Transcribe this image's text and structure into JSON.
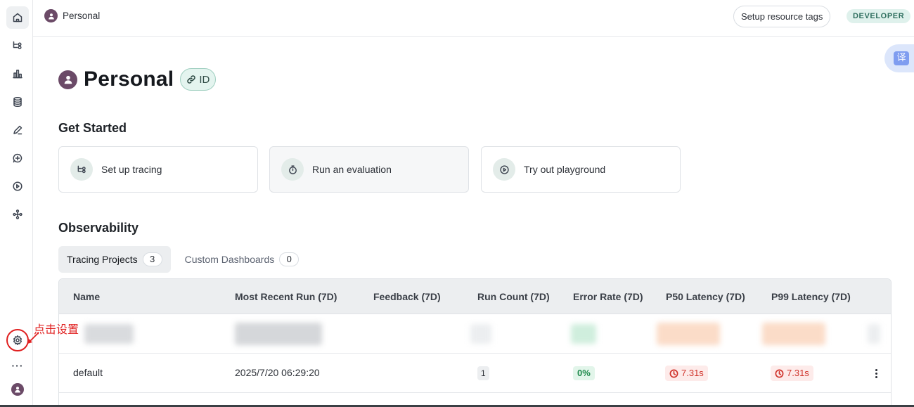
{
  "header": {
    "breadcrumb": "Personal",
    "setup_tags_label": "Setup resource tags",
    "plan_badge": "DEVELOPER"
  },
  "translate_widget": {
    "glyph": "译"
  },
  "page": {
    "title": "Personal",
    "id_chip": "ID"
  },
  "get_started": {
    "heading": "Get Started",
    "cards": [
      {
        "label": "Set up tracing",
        "icon": "tracing-icon"
      },
      {
        "label": "Run an evaluation",
        "icon": "stopwatch-icon"
      },
      {
        "label": "Try out playground",
        "icon": "play-circle-icon"
      }
    ]
  },
  "observability": {
    "heading": "Observability",
    "tabs": [
      {
        "label": "Tracing Projects",
        "count": "3"
      },
      {
        "label": "Custom Dashboards",
        "count": "0"
      }
    ],
    "table": {
      "columns": [
        "Name",
        "Most Recent Run (7D)",
        "Feedback (7D)",
        "Run Count (7D)",
        "Error Rate (7D)",
        "P50 Latency (7D)",
        "P99 Latency (7D)"
      ],
      "rows": [
        {
          "name": "default",
          "recent_run": "2025/7/20 06:29:20",
          "feedback": "",
          "run_count": "1",
          "error_rate": "0%",
          "p50": "7.31s",
          "p99": "7.31s"
        }
      ]
    }
  },
  "annotation": {
    "text": "点击设置",
    "color": "#e02020"
  },
  "colors": {
    "accent_badge_bg": "#dff1ec",
    "avatar": "#6b4a67",
    "error_red": "#d0342c",
    "success_green": "#1f8a4c"
  },
  "sidebar": {
    "items": [
      "home-icon",
      "tracing-icon",
      "monitoring-icon",
      "datasets-icon",
      "annotation-icon",
      "prompts-icon",
      "playground-icon",
      "deployments-icon"
    ],
    "more_label": "···"
  }
}
